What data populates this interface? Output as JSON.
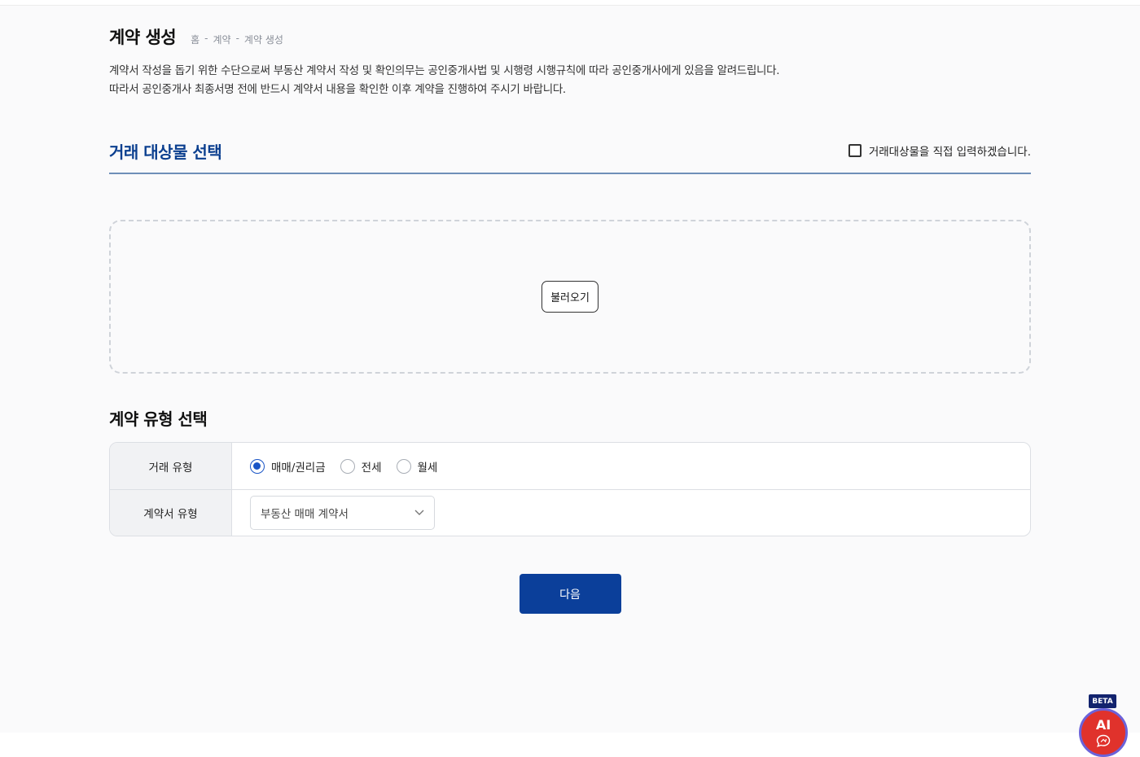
{
  "header": {
    "title": "계약 생성",
    "breadcrumb": [
      "홈",
      "계약",
      "계약 생성"
    ],
    "breadcrumb_separator": "-"
  },
  "notice": {
    "line1": "계약서 작성을 돕기 위한 수단으로써 부동산 계약서 작성 및 확인의무는 공인중개사법 및 시행령 시행규칙에 따라 공인중개사에게 있음을 알려드립니다.",
    "line2": "따라서 공인중개사 최종서명 전에 반드시 계약서 내용을 확인한 이후 계약을 진행하여 주시기 바랍니다."
  },
  "target_section": {
    "title": "거래 대상물 선택",
    "direct_input_label": "거래대상물을 직접 입력하겠습니다.",
    "direct_input_checked": false,
    "load_button": "불러오기"
  },
  "contract_type_section": {
    "title": "계약 유형 선택",
    "deal_type_label": "거래 유형",
    "deal_options": [
      {
        "label": "매매/권리금",
        "checked": true
      },
      {
        "label": "전세",
        "checked": false
      },
      {
        "label": "월세",
        "checked": false
      }
    ],
    "contract_form_label": "계약서 유형",
    "contract_form_value": "부동산 매매 계약서"
  },
  "actions": {
    "next_button": "다음"
  },
  "ai_assistant": {
    "badge": "BETA",
    "label": "AI"
  },
  "colors": {
    "primary": "#0b3f9a",
    "section_blue": "#0b3f8f",
    "radio_active": "#1a55c6",
    "ai_red": "#e0322c",
    "ai_ring": "#6b62d9"
  }
}
